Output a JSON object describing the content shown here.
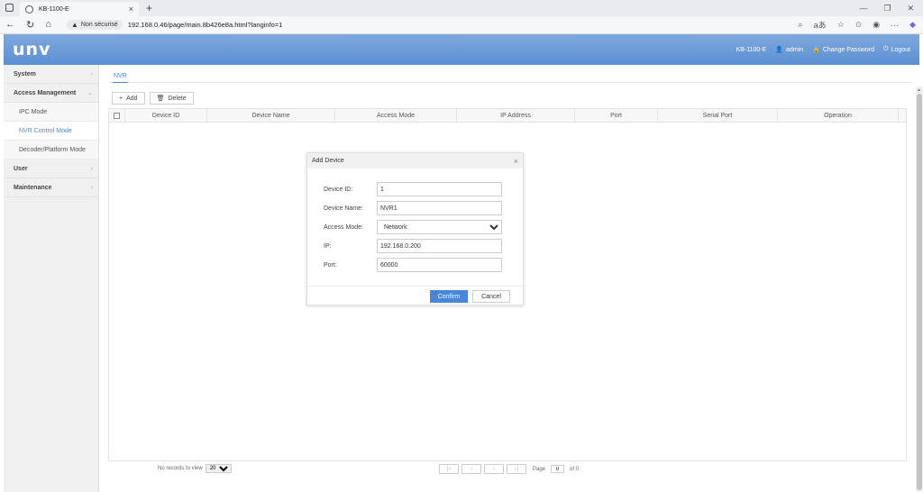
{
  "browser": {
    "tab_title": "KB-1100-E",
    "security_label": "Non sécurisé",
    "url": "192.168.0.46/page/main.8b426e8a.html?langinfo=1"
  },
  "header": {
    "logo": "unv",
    "device": "KB-1100-E",
    "user": "admin",
    "change_password": "Change Password",
    "logout": "Logout"
  },
  "sidebar": {
    "system": "System",
    "access_management": "Access Management",
    "ipc_mode": "IPC Mode",
    "nvr_control_mode": "NVR Control Mode",
    "decoder_mode": "Decoder/Platform Mode",
    "user": "User",
    "maintenance": "Maintenance"
  },
  "page": {
    "tab": "NVR",
    "add": "Add",
    "delete": "Delete",
    "columns": [
      "Device ID",
      "Device Name",
      "Access Mode",
      "IP Address",
      "Port",
      "Serial Port",
      "Operation"
    ]
  },
  "footer": {
    "records_label": "No records to view",
    "per_page": "20",
    "page_label": "Page",
    "page_value": "0",
    "of_label": "of 0"
  },
  "dialog": {
    "title": "Add Device",
    "device_id_label": "Device ID:",
    "device_id": "1",
    "device_name_label": "Device Name:",
    "device_name": "NVR1",
    "access_mode_label": "Access Mode:",
    "access_mode": "Network",
    "ip_label": "IP:",
    "ip": "192.168.0.200",
    "port_label": "Port:",
    "port": "60000",
    "confirm": "Confirm",
    "cancel": "Cancel"
  }
}
